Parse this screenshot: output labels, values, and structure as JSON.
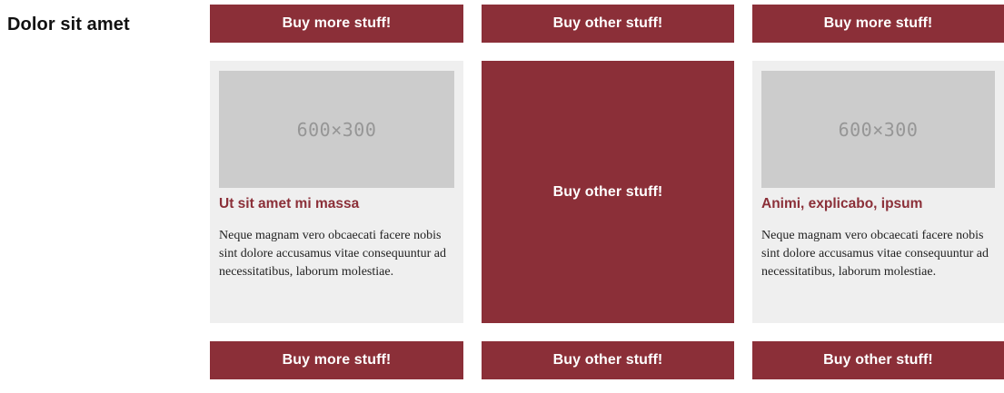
{
  "section": {
    "title": "Dolor sit amet"
  },
  "top_buttons": [
    {
      "label": "Buy more stuff!"
    },
    {
      "label": "Buy other stuff!"
    },
    {
      "label": "Buy more stuff!"
    }
  ],
  "cards": [
    {
      "image_placeholder": "600×300",
      "title": "Ut sit amet mi massa",
      "text": "Neque magnam vero obcaecati facere nobis sint dolore accusamus vitae consequuntur ad necessitatibus, laborum molestiae."
    },
    {
      "promo_label": "Buy other stuff!"
    },
    {
      "image_placeholder": "600×300",
      "title": "Animi, explicabo, ipsum",
      "text": "Neque magnam vero obcaecati facere nobis sint dolore accusamus vitae consequuntur ad necessitatibus, laborum molestiae."
    }
  ],
  "bottom_buttons": [
    {
      "label": "Buy more stuff!"
    },
    {
      "label": "Buy other stuff!"
    },
    {
      "label": "Buy other stuff!"
    }
  ],
  "colors": {
    "accent": "#8b2f38",
    "card_bg": "#efefef",
    "placeholder_bg": "#cccccc",
    "placeholder_text": "#969696"
  }
}
